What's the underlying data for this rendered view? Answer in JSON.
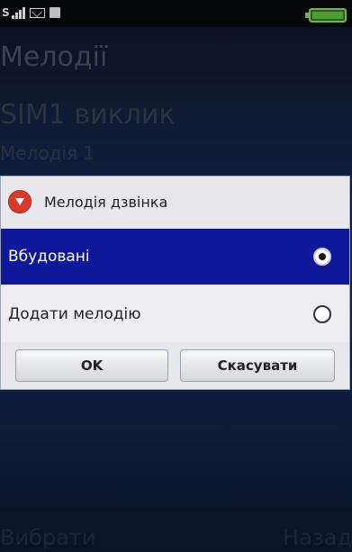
{
  "status_bar": {
    "sim_label": "S",
    "icons": [
      "signal-icon",
      "message-icon",
      "sd-card-icon",
      "battery-icon"
    ]
  },
  "background": {
    "title": "Мелодії",
    "item_title": "SIM1 виклик",
    "item_value": "Мелодія 1",
    "softkey_left": "Вибрати",
    "softkey_right": "Назад"
  },
  "dialog": {
    "title": "Мелодія дзвінка",
    "options": [
      {
        "label": "Вбудовані",
        "selected": true
      },
      {
        "label": "Додати мелодію",
        "selected": false
      }
    ],
    "ok_label": "OK",
    "cancel_label": "Скасувати"
  },
  "colors": {
    "selected_row": "#10189a",
    "dialog_bg": "#e8e8ec",
    "icon_red": "#d9382b"
  }
}
